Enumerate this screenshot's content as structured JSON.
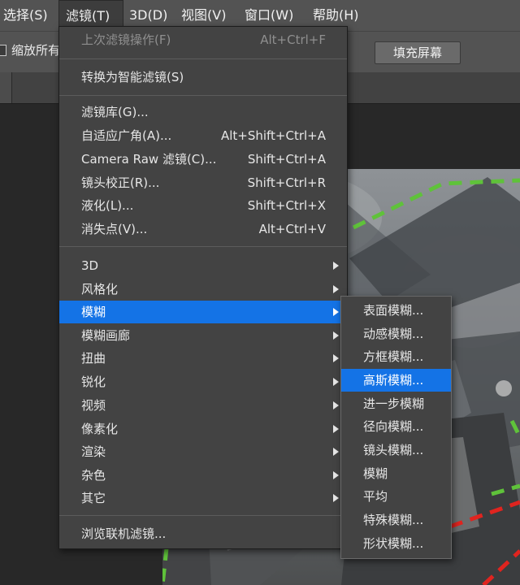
{
  "menubar": {
    "items": [
      {
        "label": "选择(S)"
      },
      {
        "label": "滤镜(T)"
      },
      {
        "label": "3D(D)"
      },
      {
        "label": "视图(V)"
      },
      {
        "label": "窗口(W)"
      },
      {
        "label": "帮助(H)"
      }
    ]
  },
  "optionsbar": {
    "partial_label": "缩放所有",
    "fill_screen_button": "填充屏幕"
  },
  "filter_menu": {
    "last_filter": {
      "label": "上次滤镜操作(F)",
      "shortcut": "Alt+Ctrl+F"
    },
    "convert_smart": {
      "label": "转换为智能滤镜(S)"
    },
    "gallery": {
      "label": "滤镜库(G)..."
    },
    "adaptive_wide": {
      "label": "自适应广角(A)...",
      "shortcut": "Alt+Shift+Ctrl+A"
    },
    "camera_raw": {
      "label": "Camera Raw 滤镜(C)...",
      "shortcut": "Shift+Ctrl+A"
    },
    "lens_correction": {
      "label": "镜头校正(R)...",
      "shortcut": "Shift+Ctrl+R"
    },
    "liquify": {
      "label": "液化(L)...",
      "shortcut": "Shift+Ctrl+X"
    },
    "vanishing_point": {
      "label": "消失点(V)...",
      "shortcut": "Alt+Ctrl+V"
    },
    "submenus": [
      {
        "label": "3D"
      },
      {
        "label": "风格化"
      },
      {
        "label": "模糊"
      },
      {
        "label": "模糊画廊"
      },
      {
        "label": "扭曲"
      },
      {
        "label": "锐化"
      },
      {
        "label": "视频"
      },
      {
        "label": "像素化"
      },
      {
        "label": "渲染"
      },
      {
        "label": "杂色"
      },
      {
        "label": "其它"
      }
    ],
    "browse_online": {
      "label": "浏览联机滤镜..."
    }
  },
  "blur_submenu": {
    "items": [
      {
        "label": "表面模糊..."
      },
      {
        "label": "动感模糊..."
      },
      {
        "label": "方框模糊..."
      },
      {
        "label": "高斯模糊..."
      },
      {
        "label": "进一步模糊"
      },
      {
        "label": "径向模糊..."
      },
      {
        "label": "镜头模糊..."
      },
      {
        "label": "模糊"
      },
      {
        "label": "平均"
      },
      {
        "label": "特殊模糊..."
      },
      {
        "label": "形状模糊..."
      }
    ]
  },
  "colors": {
    "highlight": "#1473e6",
    "menu_bg": "#434343",
    "chrome_bg": "#535353",
    "workspace_bg": "#282828",
    "selection_green": "#5fc23a",
    "selection_red": "#e0241f"
  }
}
